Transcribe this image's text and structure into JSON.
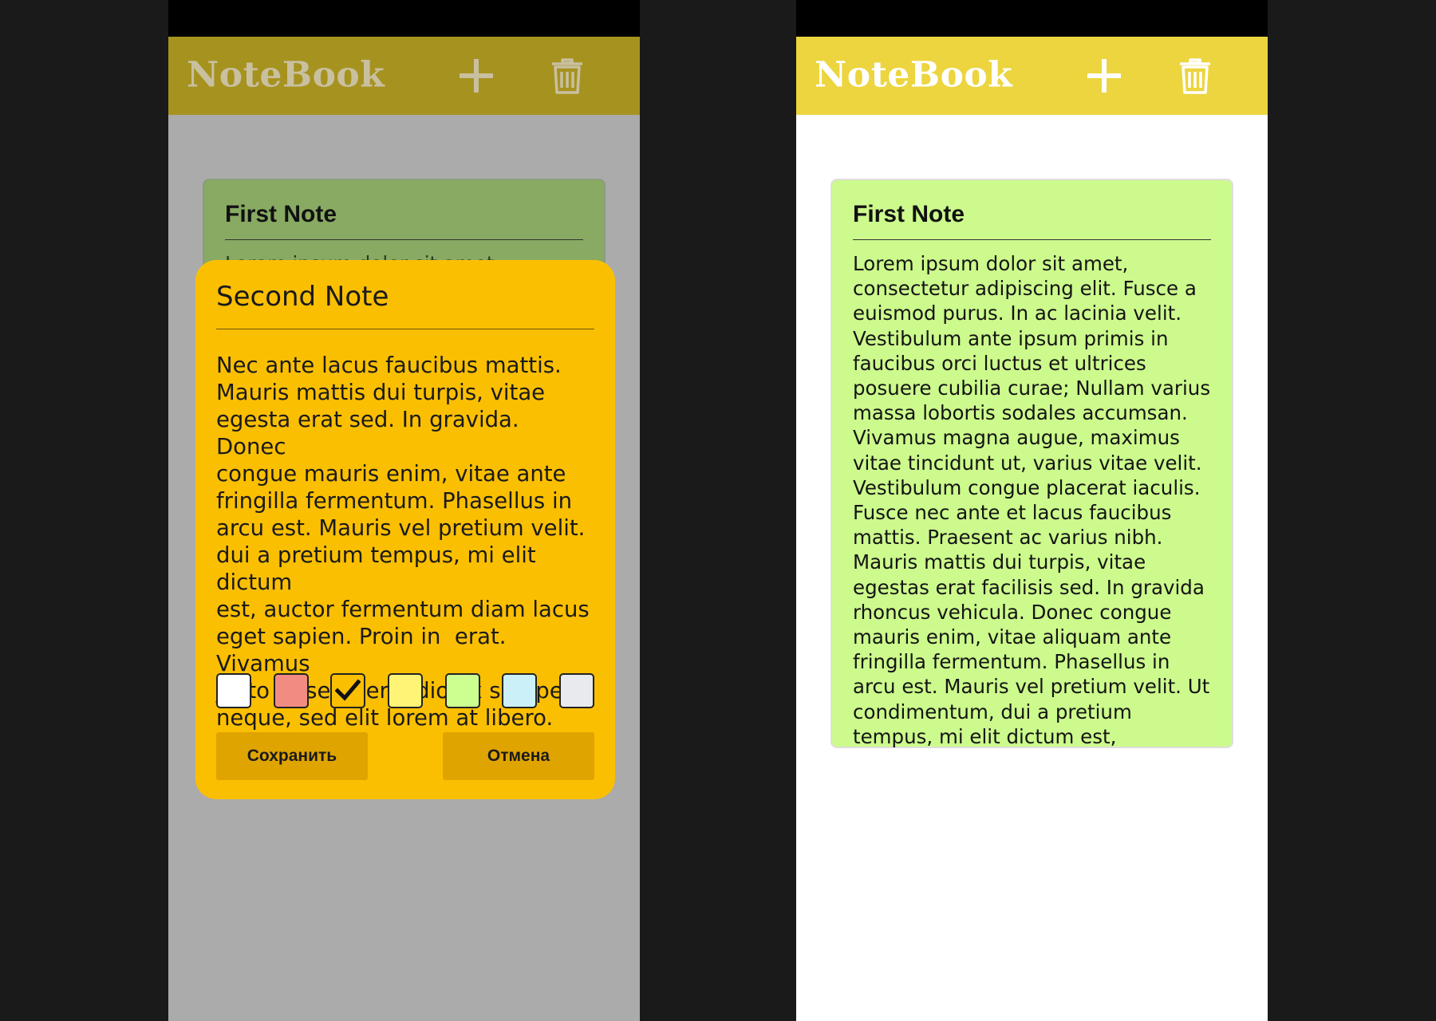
{
  "app": {
    "title": "NoteBook",
    "add_icon": "plus-icon",
    "delete_icon": "trash-icon",
    "colors": {
      "header_active": "#ecd53e",
      "header_dimmed": "#a6921f",
      "overlay_background": "#ababab",
      "dialog_background": "#fbbf02",
      "button_background": "#dfa400",
      "first_note_color": "#ccfa8c"
    }
  },
  "left_screen": {
    "first_note": {
      "title": "First Note",
      "body_preview": "Lorem ipsum dolor sit amet,"
    },
    "dialog": {
      "title": "Second Note",
      "body": "Nec ante lacus faucibus mattis.\nMauris mattis dui turpis, vitae\negesta erat sed. In gravida. Donec\ncongue mauris enim, vitae ante\nfringilla fermentum. Phasellus in\narcu est. Mauris vel pretium velit.\ndui a pretium tempus, mi elit dictum\nest, auctor fermentum diam lacus\neget sapien. Proin in  erat. Vivamus\njusto at semper, odio ex semper\nneque, sed elit lorem at libero.",
      "color_options": [
        {
          "name": "white",
          "color": "#ffffff",
          "selected": false
        },
        {
          "name": "red",
          "color": "#f28b82",
          "selected": false
        },
        {
          "name": "orange",
          "color": "#fbbf02",
          "selected": true
        },
        {
          "name": "yellow",
          "color": "#fff475",
          "selected": false
        },
        {
          "name": "green",
          "color": "#ccff90",
          "selected": false
        },
        {
          "name": "blue",
          "color": "#cbf0f8",
          "selected": false
        },
        {
          "name": "gray",
          "color": "#e8eaed",
          "selected": false
        }
      ],
      "save_label": "Сохранить",
      "cancel_label": "Отмена"
    }
  },
  "right_screen": {
    "first_note": {
      "title": "First Note",
      "body": "Lorem ipsum dolor sit amet, consectetur adipiscing elit. Fusce a euismod purus. In ac lacinia velit. Vestibulum ante ipsum primis in faucibus orci luctus et ultrices posuere cubilia curae; Nullam varius massa lobortis sodales accumsan. Vivamus magna augue, maximus vitae tincidunt ut, varius vitae velit. Vestibulum congue placerat iaculis. Fusce nec ante et lacus faucibus mattis. Praesent ac varius nibh. Mauris mattis dui turpis, vitae egestas erat facilisis sed. In gravida rhoncus vehicula. Donec congue mauris enim, vitae aliquam ante fringilla fermentum. Phasellus in arcu est. Mauris vel pretium velit. Ut condimentum, dui a pretium tempus, mi elit dictum est,"
    }
  }
}
